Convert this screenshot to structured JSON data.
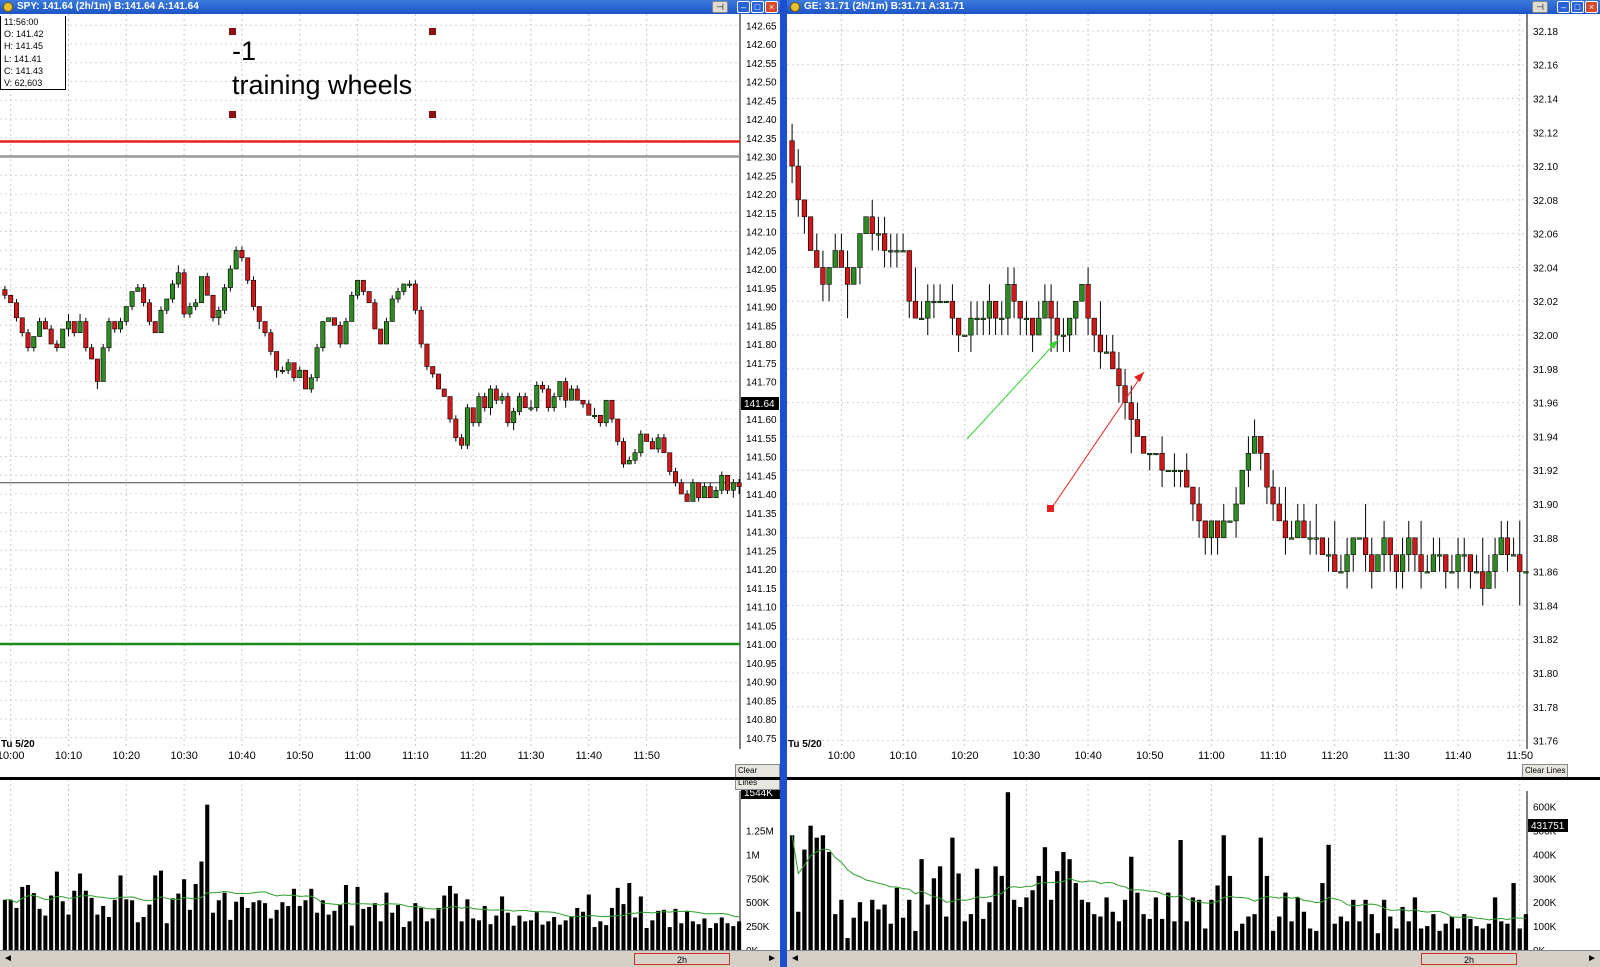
{
  "left_window": {
    "title": "SPY: 141.64 (2h/1m)  B:141.64 A:141.64",
    "ohlc": [
      "11:56:00",
      "O: 141.42",
      "H: 141.45",
      "L: 141.41",
      "C: 141.43",
      "V: 62,603"
    ],
    "annotation_line1": "-1",
    "annotation_line2": "training wheels",
    "clear_lines": "Clear Lines",
    "scroll_label": "2h",
    "day_label": "Tu 5/20",
    "current_price_label": "141.64",
    "volume_marker_label": "1544K"
  },
  "right_window": {
    "title": "GE: 31.71 (2h/1m)  B:31.71 A:31.71",
    "clear_lines": "Clear Lines",
    "scroll_label": "2h",
    "day_label": "Tu 5/20",
    "volume_marker_label": "431751"
  },
  "colors": {
    "up": "#2e8b22",
    "down": "#d01818",
    "resistance_line": "#e82020",
    "support_line": "#1a8a1a",
    "moving_average": "#2ea02e",
    "title_bar": "#1d54c6"
  },
  "chart_data": [
    {
      "type": "candlestick",
      "symbol": "SPY",
      "interval": "1m",
      "x_ticks": [
        "10:00",
        "10:10",
        "10:20",
        "10:30",
        "10:40",
        "10:50",
        "11:00",
        "11:10",
        "11:20",
        "11:30",
        "11:40",
        "11:50"
      ],
      "y_ticks": [
        "142.65",
        "142.60",
        "142.55",
        "142.50",
        "142.45",
        "142.40",
        "142.35",
        "142.30",
        "142.25",
        "142.20",
        "142.15",
        "142.10",
        "142.05",
        "142.00",
        "141.95",
        "141.90",
        "141.85",
        "141.80",
        "141.75",
        "141.70",
        "141.65",
        "141.60",
        "141.55",
        "141.50",
        "141.45",
        "141.40",
        "141.35",
        "141.30",
        "141.25",
        "141.20",
        "141.15",
        "141.10",
        "141.05",
        "141.00",
        "140.95",
        "140.90",
        "140.85",
        "140.80",
        "140.75"
      ],
      "ylim": [
        140.72,
        142.68
      ],
      "horizontal_lines": [
        {
          "price": 142.34,
          "color": "red"
        },
        {
          "price": 142.3,
          "color": "gray"
        },
        {
          "price": 141.43,
          "color": "black"
        },
        {
          "price": 141.0,
          "color": "green"
        }
      ],
      "close": [
        141.93,
        141.91,
        141.87,
        141.83,
        141.79,
        141.82,
        141.86,
        141.84,
        141.8,
        141.79,
        141.84,
        141.86,
        141.83,
        141.86,
        141.79,
        141.76,
        141.7,
        141.79,
        141.86,
        141.84,
        141.86,
        141.9,
        141.94,
        141.95,
        141.91,
        141.86,
        141.83,
        141.89,
        141.92,
        141.96,
        141.99,
        141.88,
        141.9,
        141.91,
        141.98,
        141.93,
        141.87,
        141.89,
        141.95,
        142.0,
        142.05,
        142.03,
        141.97,
        141.9,
        141.86,
        141.83,
        141.78,
        141.73,
        141.73,
        141.75,
        141.71,
        141.73,
        141.68,
        141.71,
        141.79,
        141.86,
        141.87,
        141.85,
        141.8,
        141.86,
        141.93,
        141.97,
        141.94,
        141.91,
        141.84,
        141.8,
        141.86,
        141.92,
        141.94,
        141.96,
        141.96,
        141.89,
        141.8,
        141.74,
        141.72,
        141.68,
        141.66,
        141.6,
        141.55,
        141.53,
        141.63,
        141.59,
        141.66,
        141.63,
        141.68,
        141.65,
        141.66,
        141.59,
        141.62,
        141.66,
        141.63,
        141.63,
        141.69,
        141.68,
        141.63,
        141.66,
        141.7,
        141.65,
        141.68,
        141.65,
        141.64,
        141.61,
        141.61,
        141.59,
        141.65,
        141.6,
        141.54,
        141.48,
        141.49,
        141.51,
        141.56,
        141.54,
        141.52,
        141.55,
        141.51,
        141.46,
        141.43,
        141.4,
        141.38,
        141.43,
        141.39,
        141.42,
        141.39,
        141.41,
        141.45,
        141.41,
        141.43,
        141.42
      ],
      "volume": [
        525000,
        525000,
        440000,
        660000,
        680000,
        595000,
        430000,
        360000,
        570000,
        820000,
        510000,
        370000,
        620000,
        800000,
        620000,
        545000,
        370000,
        460000,
        345000,
        525000,
        780000,
        530000,
        520000,
        290000,
        345000,
        475000,
        780000,
        830000,
        280000,
        540000,
        590000,
        740000,
        420000,
        690000,
        925000,
        1520000,
        390000,
        520000,
        600000,
        315000,
        505000,
        555000,
        440000,
        500000,
        520000,
        490000,
        330000,
        420000,
        500000,
        460000,
        640000,
        460000,
        520000,
        640000,
        390000,
        520000,
        370000,
        410000,
        470000,
        680000,
        255000,
        660000,
        430000,
        450000,
        490000,
        300000,
        600000,
        390000,
        470000,
        240000,
        300000,
        490000,
        440000,
        300000,
        330000,
        440000,
        570000,
        670000,
        590000,
        300000,
        530000,
        330000,
        310000,
        460000,
        270000,
        360000,
        560000,
        390000,
        255000,
        360000,
        300000,
        310000,
        395000,
        265000,
        300000,
        345000,
        265000,
        310000,
        345000,
        440000,
        400000,
        580000,
        240000,
        300000,
        260000,
        440000,
        650000,
        480000,
        700000,
        340000,
        560000,
        230000,
        310000,
        410000,
        420000,
        240000,
        430000,
        280000,
        410000,
        300000,
        270000,
        330000,
        230000,
        280000,
        340000,
        280000,
        250000,
        300000
      ]
    },
    {
      "type": "candlestick",
      "symbol": "GE",
      "interval": "1m",
      "x_ticks": [
        "10:00",
        "10:10",
        "10:20",
        "10:30",
        "10:40",
        "10:50",
        "11:00",
        "11:10",
        "11:20",
        "11:30",
        "11:40",
        "11:50"
      ],
      "y_ticks": [
        "32.18",
        "32.16",
        "32.14",
        "32.12",
        "32.10",
        "32.08",
        "32.06",
        "32.04",
        "32.02",
        "32.00",
        "31.98",
        "31.96",
        "31.94",
        "31.92",
        "31.90",
        "31.88",
        "31.86",
        "31.84",
        "31.82",
        "31.80",
        "31.78",
        "31.76"
      ],
      "ylim": [
        31.755,
        32.19
      ],
      "close": [
        32.1,
        32.08,
        32.07,
        32.05,
        32.04,
        32.03,
        32.04,
        32.05,
        32.04,
        32.03,
        32.04,
        32.06,
        32.07,
        32.06,
        32.06,
        32.05,
        32.05,
        32.05,
        32.05,
        32.02,
        32.01,
        32.01,
        32.02,
        32.02,
        32.02,
        32.02,
        32.01,
        32.0,
        32.0,
        32.01,
        32.01,
        32.01,
        32.02,
        32.01,
        32.01,
        32.03,
        32.02,
        32.01,
        32.01,
        32.0,
        32.01,
        32.02,
        32.01,
        32.0,
        32.0,
        32.01,
        32.02,
        32.03,
        32.01,
        32.0,
        31.99,
        31.99,
        31.98,
        31.97,
        31.96,
        31.95,
        31.94,
        31.93,
        31.93,
        31.93,
        31.92,
        31.92,
        31.92,
        31.92,
        31.91,
        31.9,
        31.89,
        31.88,
        31.89,
        31.88,
        31.89,
        31.89,
        31.9,
        31.92,
        31.93,
        31.94,
        31.93,
        31.91,
        31.9,
        31.89,
        31.88,
        31.88,
        31.89,
        31.88,
        31.88,
        31.88,
        31.87,
        31.87,
        31.86,
        31.86,
        31.87,
        31.88,
        31.88,
        31.87,
        31.86,
        31.87,
        31.88,
        31.87,
        31.86,
        31.87,
        31.88,
        31.87,
        31.86,
        31.86,
        31.87,
        31.87,
        31.86,
        31.86,
        31.87,
        31.87,
        31.86,
        31.86,
        31.85,
        31.86,
        31.87,
        31.88,
        31.87,
        31.87,
        31.86,
        31.86
      ],
      "volume": [
        480000,
        160000,
        420000,
        520000,
        470000,
        480000,
        410000,
        150000,
        210000,
        50000,
        135000,
        200000,
        120000,
        210000,
        170000,
        190000,
        110000,
        260000,
        135000,
        210000,
        80000,
        380000,
        190000,
        300000,
        350000,
        140000,
        470000,
        320000,
        120000,
        150000,
        340000,
        130000,
        200000,
        350000,
        310000,
        660000,
        210000,
        180000,
        220000,
        250000,
        310000,
        430000,
        210000,
        330000,
        410000,
        380000,
        280000,
        210000,
        200000,
        150000,
        140000,
        220000,
        160000,
        120000,
        210000,
        390000,
        240000,
        150000,
        130000,
        220000,
        130000,
        240000,
        120000,
        460000,
        120000,
        220000,
        210000,
        90000,
        210000,
        270000,
        480000,
        310000,
        80000,
        110000,
        140000,
        150000,
        470000,
        310000,
        80000,
        140000,
        240000,
        120000,
        220000,
        160000,
        90000,
        80000,
        280000,
        440000,
        110000,
        140000,
        120000,
        210000,
        120000,
        210000,
        150000,
        70000,
        210000,
        140000,
        90000,
        180000,
        120000,
        220000,
        90000,
        100000,
        150000,
        80000,
        110000,
        140000,
        90000,
        150000,
        130000,
        100000,
        90000,
        110000,
        220000,
        120000,
        110000,
        280000,
        90000,
        150000
      ]
    }
  ]
}
